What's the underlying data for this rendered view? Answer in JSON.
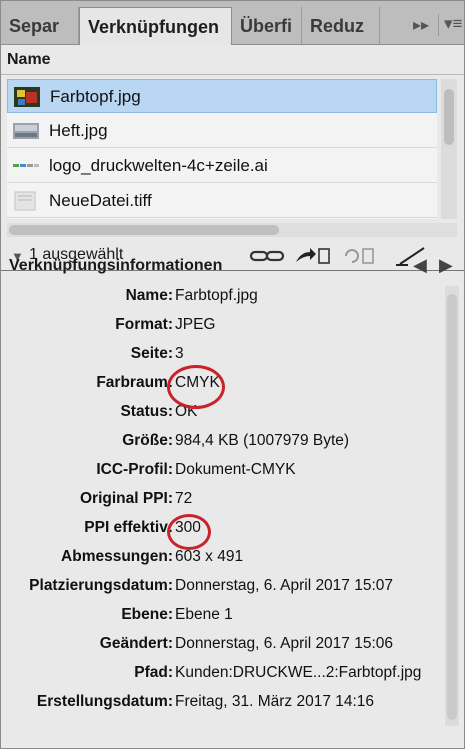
{
  "tabs": [
    {
      "label": "Separ",
      "active": false
    },
    {
      "label": "Verknüpfungen",
      "active": true
    },
    {
      "label": "Überfi",
      "active": false
    },
    {
      "label": "Reduz",
      "active": false
    }
  ],
  "tab_controls": {
    "more": "▸▸",
    "menu": "▾≡"
  },
  "list": {
    "column_header": "Name",
    "items": [
      {
        "name": "Farbtopf.jpg",
        "selected": true,
        "icon": "image-thumbnail-icon"
      },
      {
        "name": "Heft.jpg",
        "selected": false,
        "icon": "image-thumbnail-icon"
      },
      {
        "name": "logo_druckwelten-4c+zeile.ai",
        "selected": false,
        "icon": "logo-thumbnail-icon"
      },
      {
        "name": "NeueDatei.tiff",
        "selected": false,
        "icon": "image-thumbnail-icon"
      }
    ]
  },
  "status": {
    "selection_count": "1 ausgewählt"
  },
  "toolbar_icons": [
    "relink-icon",
    "goto-link-icon",
    "update-link-icon",
    "edit-original-icon"
  ],
  "info": {
    "title": "Verknüpfungsinformationen",
    "rows": [
      {
        "label": "Name:",
        "value": "Farbtopf.jpg"
      },
      {
        "label": "Format:",
        "value": "JPEG"
      },
      {
        "label": "Seite:",
        "value": "3"
      },
      {
        "label": "Farbraum:",
        "value": "CMYK"
      },
      {
        "label": "Status:",
        "value": "OK"
      },
      {
        "label": "Größe:",
        "value": "984,4 KB (1007979 Byte)"
      },
      {
        "label": "ICC-Profil:",
        "value": "Dokument-CMYK"
      },
      {
        "label": "Original PPI:",
        "value": "72"
      },
      {
        "label": "PPI effektiv:",
        "value": "300"
      },
      {
        "label": "Abmessungen:",
        "value": "603 x 491"
      },
      {
        "label": "Platzierungsdatum:",
        "value": "Donnerstag, 6. April 2017 15:07"
      },
      {
        "label": "Ebene:",
        "value": "Ebene 1"
      },
      {
        "label": "Geändert:",
        "value": "Donnerstag, 6. April 2017 15:06"
      },
      {
        "label": "Pfad:",
        "value": "Kunden:DRUCKWE...2:Farbtopf.jpg"
      },
      {
        "label": "Erstellungsdatum:",
        "value": "Freitag, 31. März 2017 14:16"
      }
    ]
  },
  "colors": {
    "highlight_circle": "#c8222a",
    "selection": "#b9d7f3"
  }
}
